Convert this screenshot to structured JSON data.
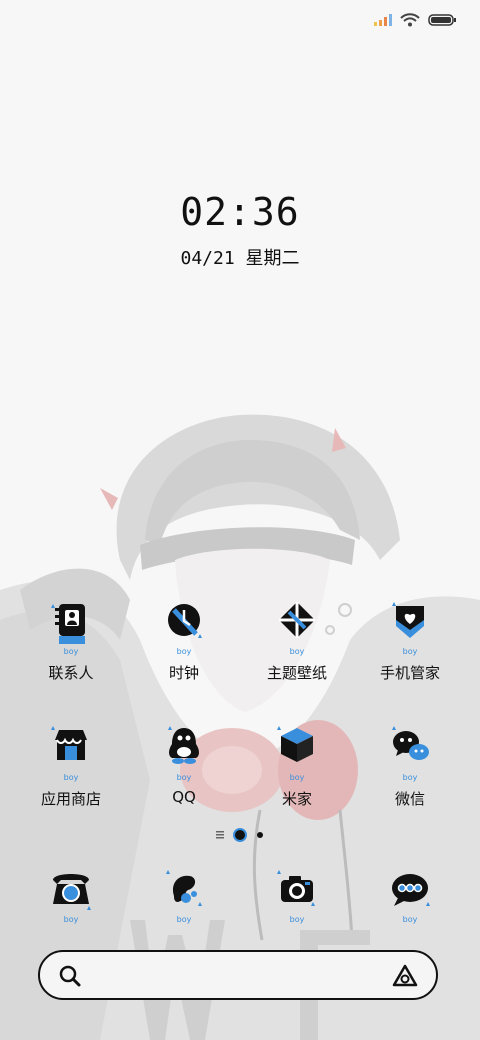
{
  "status_bar": {
    "icons": [
      "signal-icon",
      "wifi-icon",
      "battery-icon"
    ],
    "signal_colors": [
      "#f0c34a",
      "#f0a04a",
      "#e8864a",
      "#7fb3e6"
    ]
  },
  "clock": {
    "time": "02:36"
  },
  "date": {
    "text": "04/21 星期二"
  },
  "apps": [
    {
      "label": "联系人",
      "icon": "contacts-icon"
    },
    {
      "label": "时钟",
      "icon": "clock-icon"
    },
    {
      "label": "主题壁纸",
      "icon": "themes-icon"
    },
    {
      "label": "手机管家",
      "icon": "security-icon"
    },
    {
      "label": "应用商店",
      "icon": "app-store-icon"
    },
    {
      "label": "QQ",
      "icon": "qq-icon"
    },
    {
      "label": "米家",
      "icon": "mijia-icon"
    },
    {
      "label": "微信",
      "icon": "wechat-icon"
    }
  ],
  "icon_badge": "boy",
  "dock": [
    {
      "icon": "phone-icon"
    },
    {
      "icon": "gallery-icon"
    },
    {
      "icon": "camera-icon"
    },
    {
      "icon": "messages-icon"
    }
  ],
  "search": {
    "icons": [
      "search-icon",
      "assistant-icon"
    ]
  },
  "colors": {
    "accent": "#3a8fdc",
    "ink": "#111111",
    "background": "#f7f7f7"
  }
}
